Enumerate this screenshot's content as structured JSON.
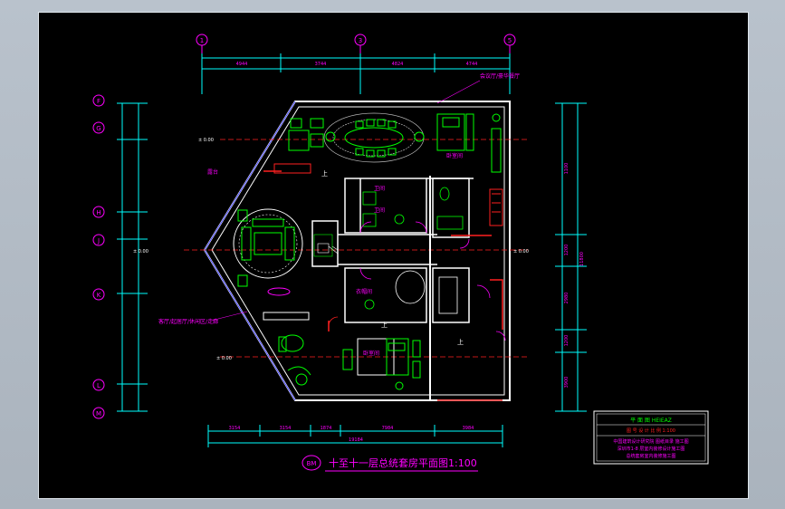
{
  "drawing": {
    "title": "十至十一层总统套房平面图",
    "scale": "1:100",
    "title_tag": "BM"
  },
  "grid_top": {
    "bubbles": [
      "1",
      "3",
      "5"
    ],
    "dimensions": [
      "4944",
      "3744",
      "4824",
      "4744"
    ]
  },
  "grid_left": {
    "bubbles": [
      "F",
      "G",
      "H",
      "J",
      "K",
      "L",
      "M"
    ]
  },
  "grid_bottom": {
    "dimensions": [
      "3154",
      "3154",
      "1874",
      "7984",
      "3984"
    ],
    "total": "19184"
  },
  "grid_right": {
    "dimensions": [
      "1100",
      "1200",
      "2980",
      "1200",
      "3900"
    ],
    "total": "11800"
  },
  "rooms": {
    "dining_note": "会议厅/豪华餐厅",
    "master_bedroom": "卧室间",
    "bath_1": "卫间",
    "bath_2": "卫间",
    "dressing": "衣帽间",
    "bedroom": "卧室间",
    "living_note": "客厅/起居厅/休闲区/走廊",
    "terrace": "露台"
  },
  "annotations": {
    "up_marks": [
      "上",
      "上",
      "上"
    ],
    "level_marks": [
      "± 0.00",
      "± 0.00",
      "± 0.00",
      "± 0.00"
    ]
  },
  "legend": {
    "header": "平 面 图    HEIEAZ",
    "row1": "图 号   设 计   比 例 1:100",
    "row2": "中国建筑设计研究院 图纸目录 施工图",
    "row3": "深圳市1-8 层室内装修设计施工图",
    "row4": "总统套房室内装修施工图"
  },
  "colors": {
    "background": "#000000",
    "dimension": "#00ffff",
    "wall": "#ffffff",
    "furniture": "#00ff00",
    "text": "#ff00ff",
    "accent_red": "#ff2020",
    "window": "#4040ff"
  }
}
